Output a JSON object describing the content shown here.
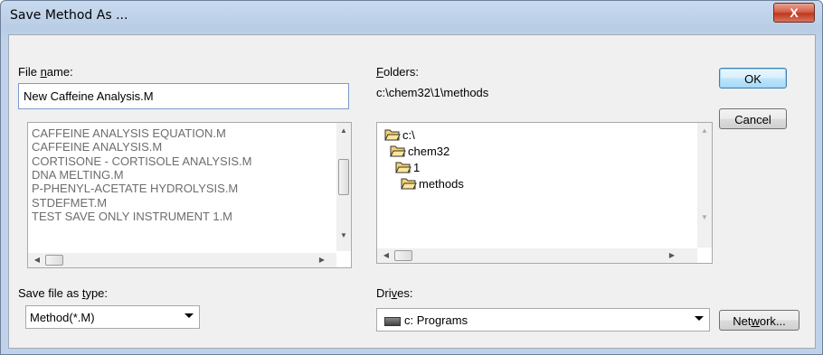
{
  "window": {
    "title": "Save Method As ...",
    "close_glyph": "X"
  },
  "file_name": {
    "label_pre": "File ",
    "label_ul": "n",
    "label_post": "ame:",
    "value": "New Caffeine Analysis.M"
  },
  "files": [
    "CAFFEINE ANALYSIS EQUATION.M",
    "CAFFEINE ANALYSIS.M",
    "CORTISONE - CORTISOLE ANALYSIS.M",
    "DNA MELTING.M",
    "P-PHENYL-ACETATE HYDROLYSIS.M",
    "STDEFMET.M",
    "TEST SAVE ONLY INSTRUMENT 1.M"
  ],
  "folders": {
    "label_ul": "F",
    "label_post": "olders:",
    "path": "c:\\chem32\\1\\methods",
    "items": [
      {
        "name": "c:\\",
        "icon": "open-folder-icon"
      },
      {
        "name": "chem32",
        "icon": "open-folder-icon"
      },
      {
        "name": "1",
        "icon": "open-folder-icon"
      },
      {
        "name": "methods",
        "icon": "open-folder-icon"
      }
    ]
  },
  "save_type": {
    "label_pre": "Save file as ",
    "label_ul": "t",
    "label_post": "ype:",
    "value": "Method(*.M)"
  },
  "drives": {
    "label_pre": "Dri",
    "label_ul": "v",
    "label_post": "es:",
    "value": "c: Programs",
    "icon": "drive-icon"
  },
  "buttons": {
    "ok": "OK",
    "cancel": "Cancel",
    "network_pre": "Net",
    "network_ul": "w",
    "network_post": "ork..."
  },
  "colors": {
    "title_bar": "#c8daef",
    "dialog_bg": "#f0f0f0",
    "close_button": "#c0381e",
    "text_field_border": "#7a9cc9",
    "folder_icon": "#f5d26a"
  }
}
